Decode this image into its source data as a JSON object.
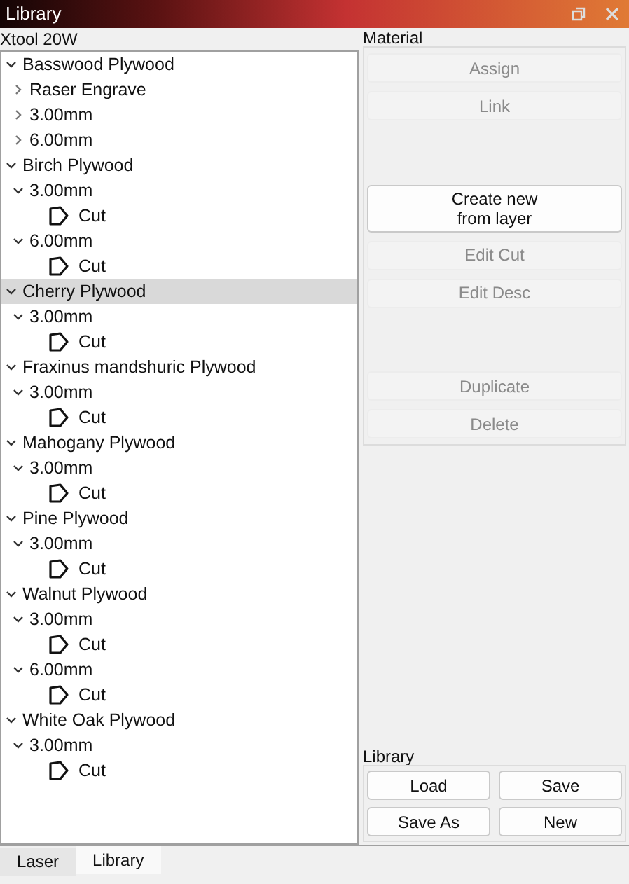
{
  "window": {
    "title": "Library"
  },
  "device": {
    "label": "Xtool 20W"
  },
  "tree": [
    {
      "label": "Basswood Plywood",
      "expanded": true,
      "selected": false,
      "children": [
        {
          "label": "Raser Engrave",
          "expanded": false,
          "selected": false
        },
        {
          "label": "3.00mm",
          "expanded": false,
          "selected": false
        },
        {
          "label": "6.00mm",
          "expanded": false,
          "selected": false
        }
      ]
    },
    {
      "label": "Birch Plywood",
      "expanded": true,
      "selected": false,
      "children": [
        {
          "label": "3.00mm",
          "expanded": true,
          "selected": false,
          "children": [
            {
              "label": "Cut",
              "selected": false
            }
          ]
        },
        {
          "label": "6.00mm",
          "expanded": true,
          "selected": false,
          "children": [
            {
              "label": "Cut",
              "selected": false
            }
          ]
        }
      ]
    },
    {
      "label": "Cherry Plywood",
      "expanded": true,
      "selected": true,
      "children": [
        {
          "label": "3.00mm",
          "expanded": true,
          "selected": false,
          "children": [
            {
              "label": "Cut",
              "selected": false
            }
          ]
        }
      ]
    },
    {
      "label": "Fraxinus mandshuric Plywood",
      "expanded": true,
      "selected": false,
      "children": [
        {
          "label": "3.00mm",
          "expanded": true,
          "selected": false,
          "children": [
            {
              "label": "Cut",
              "selected": false
            }
          ]
        }
      ]
    },
    {
      "label": "Mahogany Plywood",
      "expanded": true,
      "selected": false,
      "children": [
        {
          "label": "3.00mm",
          "expanded": true,
          "selected": false,
          "children": [
            {
              "label": "Cut",
              "selected": false
            }
          ]
        }
      ]
    },
    {
      "label": "Pine Plywood",
      "expanded": true,
      "selected": false,
      "children": [
        {
          "label": "3.00mm",
          "expanded": true,
          "selected": false,
          "children": [
            {
              "label": "Cut",
              "selected": false
            }
          ]
        }
      ]
    },
    {
      "label": "Walnut Plywood",
      "expanded": true,
      "selected": false,
      "children": [
        {
          "label": "3.00mm",
          "expanded": true,
          "selected": false,
          "children": [
            {
              "label": "Cut",
              "selected": false
            }
          ]
        },
        {
          "label": "6.00mm",
          "expanded": true,
          "selected": false,
          "children": [
            {
              "label": "Cut",
              "selected": false
            }
          ]
        }
      ]
    },
    {
      "label": "White Oak Plywood",
      "expanded": true,
      "selected": false,
      "children": [
        {
          "label": "3.00mm",
          "expanded": true,
          "selected": false,
          "children": [
            {
              "label": "Cut",
              "selected": false
            }
          ]
        }
      ]
    }
  ],
  "material": {
    "title": "Material",
    "button_groups": [
      [
        {
          "label": "Assign",
          "disabled": true
        },
        {
          "label": "Link",
          "disabled": true
        }
      ],
      [
        {
          "label": "Create new\nfrom layer",
          "disabled": false
        },
        {
          "label": "Edit Cut",
          "disabled": true
        },
        {
          "label": "Edit Desc",
          "disabled": true
        }
      ],
      [
        {
          "label": "Duplicate",
          "disabled": true
        },
        {
          "label": "Delete",
          "disabled": true
        }
      ]
    ]
  },
  "library": {
    "title": "Library",
    "buttons": [
      {
        "label": "Load",
        "disabled": false
      },
      {
        "label": "Save",
        "disabled": false
      },
      {
        "label": "Save As",
        "disabled": false
      },
      {
        "label": "New",
        "disabled": false
      }
    ]
  },
  "tabs": [
    {
      "label": "Laser",
      "selected": false
    },
    {
      "label": "Library",
      "selected": true
    }
  ]
}
